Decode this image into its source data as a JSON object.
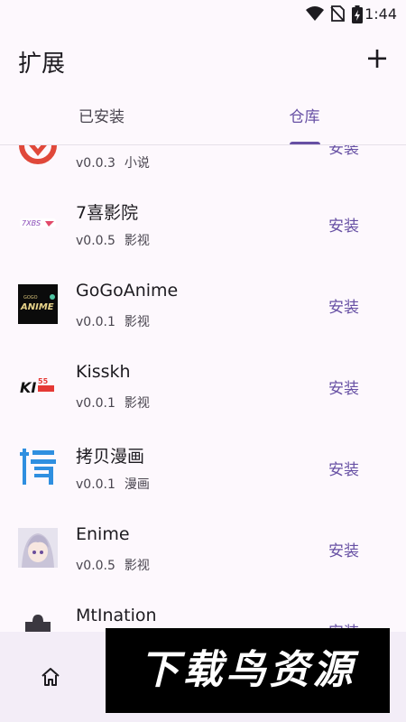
{
  "status": {
    "time": "1:44"
  },
  "appbar": {
    "title": "扩展",
    "add_label": "+"
  },
  "tabs": [
    {
      "label": "已安装",
      "active": false
    },
    {
      "label": "仓库",
      "active": true
    }
  ],
  "extensions": [
    {
      "name": "",
      "version": "v0.0.3",
      "category": "小说",
      "action": "安装",
      "icon": "red-logo-icon"
    },
    {
      "name": "7喜影院",
      "version": "v0.0.5",
      "category": "影视",
      "action": "安装",
      "icon": "7xi-logo-icon"
    },
    {
      "name": "GoGoAnime",
      "version": "v0.0.1",
      "category": "影视",
      "action": "安装",
      "icon": "gogoanime-logo-icon"
    },
    {
      "name": "Kisskh",
      "version": "v0.0.1",
      "category": "影视",
      "action": "安装",
      "icon": "kisskh-logo-icon"
    },
    {
      "name": "拷贝漫画",
      "version": "v0.0.1",
      "category": "漫画",
      "action": "安装",
      "icon": "copy-manga-logo-icon"
    },
    {
      "name": "Enime",
      "version": "v0.0.5",
      "category": "影视",
      "action": "安装",
      "icon": "enime-avatar-icon"
    },
    {
      "name": "MtInation",
      "version": "",
      "category": "",
      "action": "安装",
      "icon": "puzzle-icon"
    }
  ],
  "bottom_nav": {
    "home_icon": "home-icon"
  },
  "watermark": {
    "text": "下载鸟资源"
  },
  "colors": {
    "accent": "#6750a4",
    "background": "#fdf8fd",
    "nav": "#f3edf7"
  }
}
